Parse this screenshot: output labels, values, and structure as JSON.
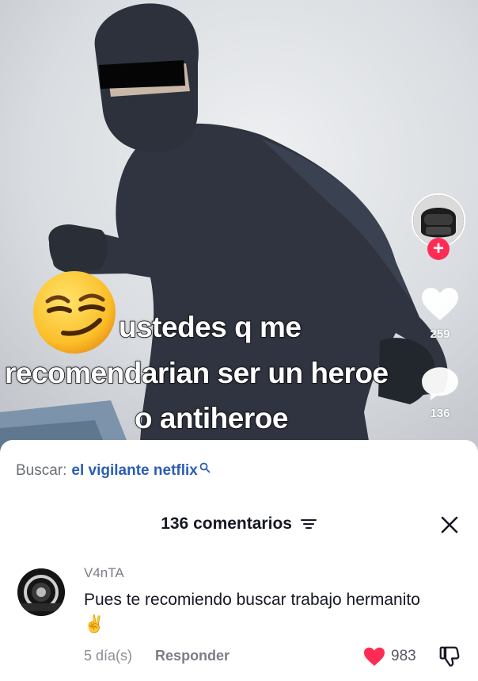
{
  "video": {
    "caption_lines": [
      "ustedes q me",
      "recomendarian ser un heroe",
      "o antiheroe"
    ],
    "caption_emoji": "smirking-face-emoji",
    "creator_follow_label": "+",
    "likes_count": "259",
    "comments_count": "136"
  },
  "sheet": {
    "search_label": "Buscar:",
    "search_query": "el vigilante netflix",
    "header_title": "136 comentarios",
    "comments": [
      {
        "username": "V4nTA",
        "text": "Pues te recomiendo buscar trabajo hermanito ✌️",
        "time": "5 día(s)",
        "reply_label": "Responder",
        "likes": "983",
        "liked": true
      }
    ]
  },
  "colors": {
    "like_red": "#fe2c55",
    "search_link_blue": "#2b5db6",
    "text_primary": "#161823",
    "text_secondary": "#8a8d93"
  },
  "icons": [
    "plus-icon",
    "heart-icon",
    "comment-bubble-icon",
    "search-icon",
    "sort-icon",
    "close-icon",
    "heart-filled-icon",
    "dislike-icon"
  ]
}
